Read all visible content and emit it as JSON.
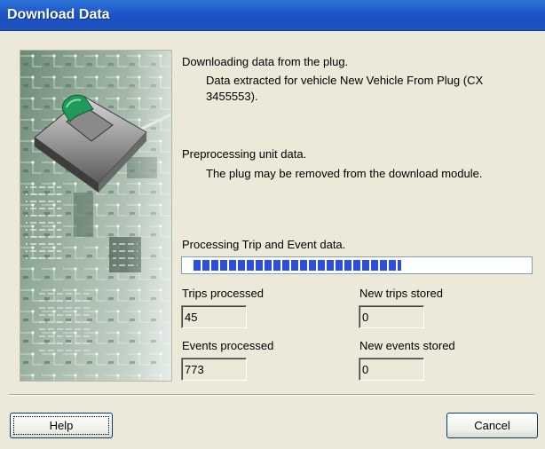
{
  "window": {
    "title": "Download Data"
  },
  "image": {
    "description_icon": "circuit-board-plug-image"
  },
  "status": {
    "downloading": "Downloading data from the plug.",
    "extracted_line1": "Data extracted for vehicle New Vehicle From Plug (CX",
    "extracted_line2": "3455553).",
    "preprocessing": "Preprocessing unit data.",
    "removable": "The plug may be removed from the download module.",
    "processing": "Processing Trip and Event data."
  },
  "progress": {
    "fraction": 0.62,
    "color": "#2a4fd8"
  },
  "fields": {
    "trips_processed_label": "Trips processed",
    "trips_processed_value": "45",
    "new_trips_label": "New trips stored",
    "new_trips_value": "0",
    "events_processed_label": "Events processed",
    "events_processed_value": "773",
    "new_events_label": "New events stored",
    "new_events_value": "0"
  },
  "buttons": {
    "help": "Help",
    "cancel": "Cancel"
  },
  "colors": {
    "titlebar": "#1b55c8",
    "dialog": "#ece9d8",
    "board": "#7f9a86",
    "plug_tab": "#1f9a5a"
  }
}
